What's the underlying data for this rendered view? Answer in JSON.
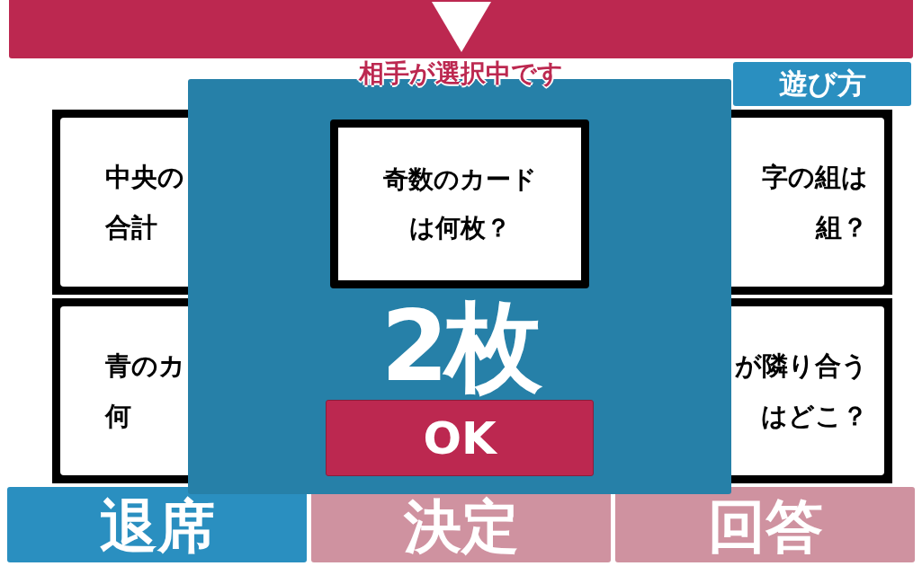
{
  "header": {
    "status": "相手が選択中です"
  },
  "help_button": {
    "label": "遊び方"
  },
  "cards": [
    {
      "kind": "left",
      "lines": [
        "中央の",
        "合計"
      ]
    },
    {
      "kind": "right",
      "lines": [
        "字の組は",
        "組？"
      ]
    },
    {
      "kind": "left",
      "lines": [
        "青のカ",
        "何"
      ]
    },
    {
      "kind": "right",
      "lines": [
        "が隣り合う",
        "はどこ？"
      ]
    }
  ],
  "dialog": {
    "card_lines": [
      "奇数のカード",
      "は何枚？"
    ],
    "answer": "2枚",
    "ok_button": "OK"
  },
  "buttons": [
    {
      "label": "退席",
      "disabled": false
    },
    {
      "label": "決定",
      "disabled": true
    },
    {
      "label": "回答",
      "disabled": true
    }
  ]
}
